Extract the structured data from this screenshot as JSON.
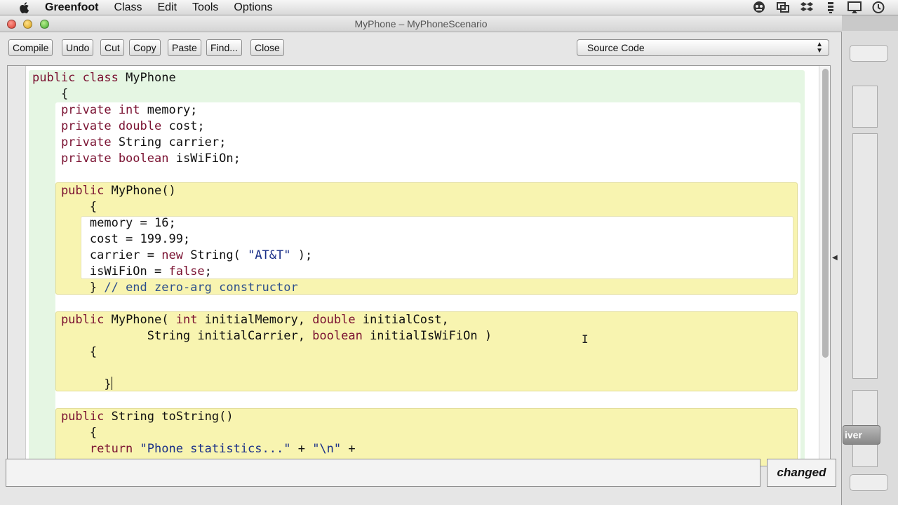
{
  "menubar": {
    "app_name": "Greenfoot",
    "items": [
      "Class",
      "Edit",
      "Tools",
      "Options"
    ],
    "tray_icons": [
      "user-icon",
      "screen-share-icon",
      "dropbox-icon",
      "sync-icon",
      "airplay-icon",
      "time-machine-icon"
    ]
  },
  "window": {
    "title": "MyPhone – MyPhoneScenario"
  },
  "toolbar": {
    "compile": "Compile",
    "undo": "Undo",
    "cut": "Cut",
    "copy": "Copy",
    "paste": "Paste",
    "find": "Find...",
    "close": "Close",
    "view_select": "Source Code"
  },
  "code": {
    "lines": [
      [
        {
          "t": "public class",
          "c": "kw"
        },
        {
          "t": " MyPhone",
          "c": ""
        }
      ],
      [
        {
          "t": "    {",
          "c": ""
        }
      ],
      [
        {
          "t": "    private int",
          "c": "kw"
        },
        {
          "t": " memory;",
          "c": ""
        }
      ],
      [
        {
          "t": "    private double",
          "c": "kw"
        },
        {
          "t": " cost;",
          "c": ""
        }
      ],
      [
        {
          "t": "    private",
          "c": "kw"
        },
        {
          "t": " String carrier;",
          "c": ""
        }
      ],
      [
        {
          "t": "    private boolean",
          "c": "kw"
        },
        {
          "t": " isWiFiOn;",
          "c": ""
        }
      ],
      [
        {
          "t": "",
          "c": ""
        }
      ],
      [
        {
          "t": "    public",
          "c": "kw"
        },
        {
          "t": " MyPhone()",
          "c": ""
        }
      ],
      [
        {
          "t": "        {",
          "c": ""
        }
      ],
      [
        {
          "t": "        memory = 16;",
          "c": ""
        }
      ],
      [
        {
          "t": "        cost = 199.99;",
          "c": ""
        }
      ],
      [
        {
          "t": "        carrier = ",
          "c": ""
        },
        {
          "t": "new",
          "c": "kw"
        },
        {
          "t": " String( ",
          "c": ""
        },
        {
          "t": "\"AT&T\"",
          "c": "str"
        },
        {
          "t": " );",
          "c": ""
        }
      ],
      [
        {
          "t": "        isWiFiOn = ",
          "c": ""
        },
        {
          "t": "false",
          "c": "kw"
        },
        {
          "t": ";",
          "c": ""
        }
      ],
      [
        {
          "t": "        } ",
          "c": ""
        },
        {
          "t": "// end zero-arg constructor",
          "c": "cm"
        }
      ],
      [
        {
          "t": "",
          "c": ""
        }
      ],
      [
        {
          "t": "    public",
          "c": "kw"
        },
        {
          "t": " MyPhone( ",
          "c": ""
        },
        {
          "t": "int",
          "c": "kw"
        },
        {
          "t": " initialMemory, ",
          "c": ""
        },
        {
          "t": "double",
          "c": "kw"
        },
        {
          "t": " initialCost,",
          "c": ""
        }
      ],
      [
        {
          "t": "                String initialCarrier, ",
          "c": ""
        },
        {
          "t": "boolean",
          "c": "kw"
        },
        {
          "t": " initialIsWiFiOn )",
          "c": ""
        }
      ],
      [
        {
          "t": "        {",
          "c": ""
        }
      ],
      [
        {
          "t": "",
          "c": ""
        }
      ],
      [
        {
          "t": "          }",
          "c": ""
        },
        {
          "t": "",
          "c": "caret"
        }
      ],
      [
        {
          "t": "",
          "c": ""
        }
      ],
      [
        {
          "t": "    public",
          "c": "kw"
        },
        {
          "t": " String toString()",
          "c": ""
        }
      ],
      [
        {
          "t": "        {",
          "c": ""
        }
      ],
      [
        {
          "t": "        return ",
          "c": "kw"
        },
        {
          "t": "\"Phone statistics...\"",
          "c": "str"
        },
        {
          "t": " + ",
          "c": ""
        },
        {
          "t": "\"\\n\"",
          "c": "str"
        },
        {
          "t": " +",
          "c": ""
        }
      ]
    ]
  },
  "background_window": {
    "action_label": "iver"
  },
  "status": {
    "message": "",
    "state": "changed"
  }
}
